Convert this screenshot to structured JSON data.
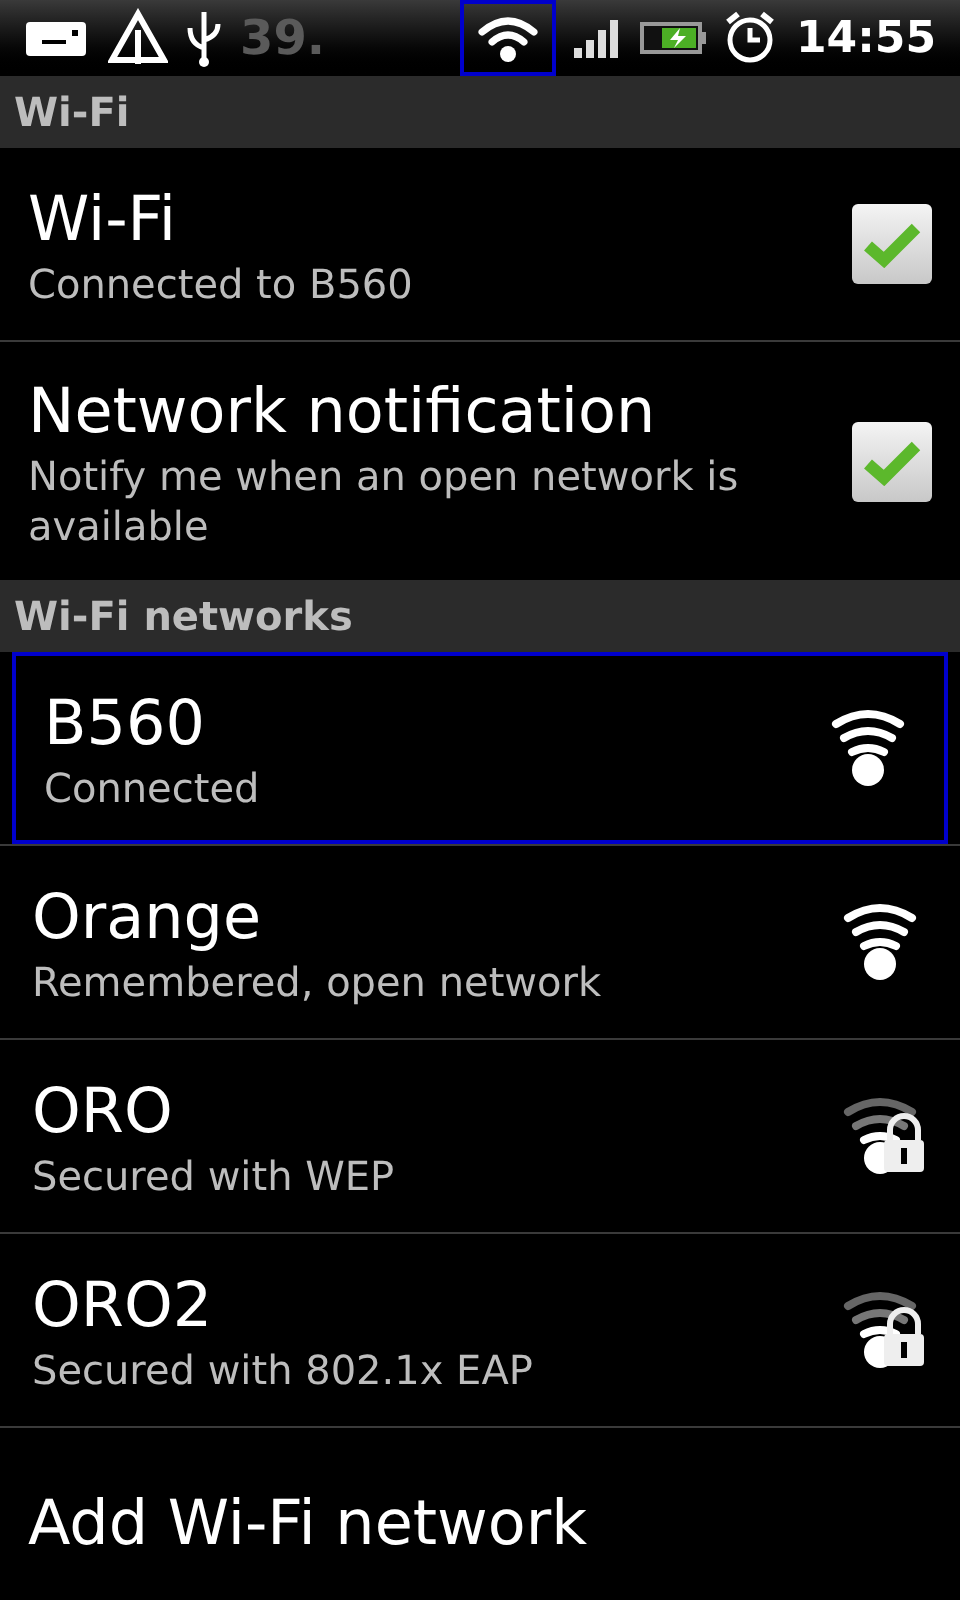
{
  "status_bar": {
    "battery_text": "39.",
    "wifi_highlighted": true,
    "time": "14:55"
  },
  "sections": [
    {
      "header": "Wi-Fi",
      "items": [
        {
          "kind": "checkbox",
          "title": "Wi-Fi",
          "summary": "Connected to B560",
          "checked": true
        },
        {
          "kind": "checkbox",
          "title": "Network notification",
          "summary": "Notify me when an open network is available",
          "checked": true
        }
      ]
    },
    {
      "header": "Wi-Fi networks",
      "items": [
        {
          "kind": "network",
          "title": "B560",
          "summary": "Connected",
          "selected": true,
          "full_signal": true,
          "secured": false
        },
        {
          "kind": "network",
          "title": "Orange",
          "summary": "Remembered, open network",
          "selected": false,
          "full_signal": true,
          "secured": false
        },
        {
          "kind": "network",
          "title": "ORO",
          "summary": "Secured with WEP",
          "selected": false,
          "full_signal": false,
          "secured": true
        },
        {
          "kind": "network",
          "title": "ORO2",
          "summary": "Secured with 802.1x EAP",
          "selected": false,
          "full_signal": false,
          "secured": true
        },
        {
          "kind": "action",
          "title": "Add Wi-Fi network"
        }
      ]
    }
  ]
}
